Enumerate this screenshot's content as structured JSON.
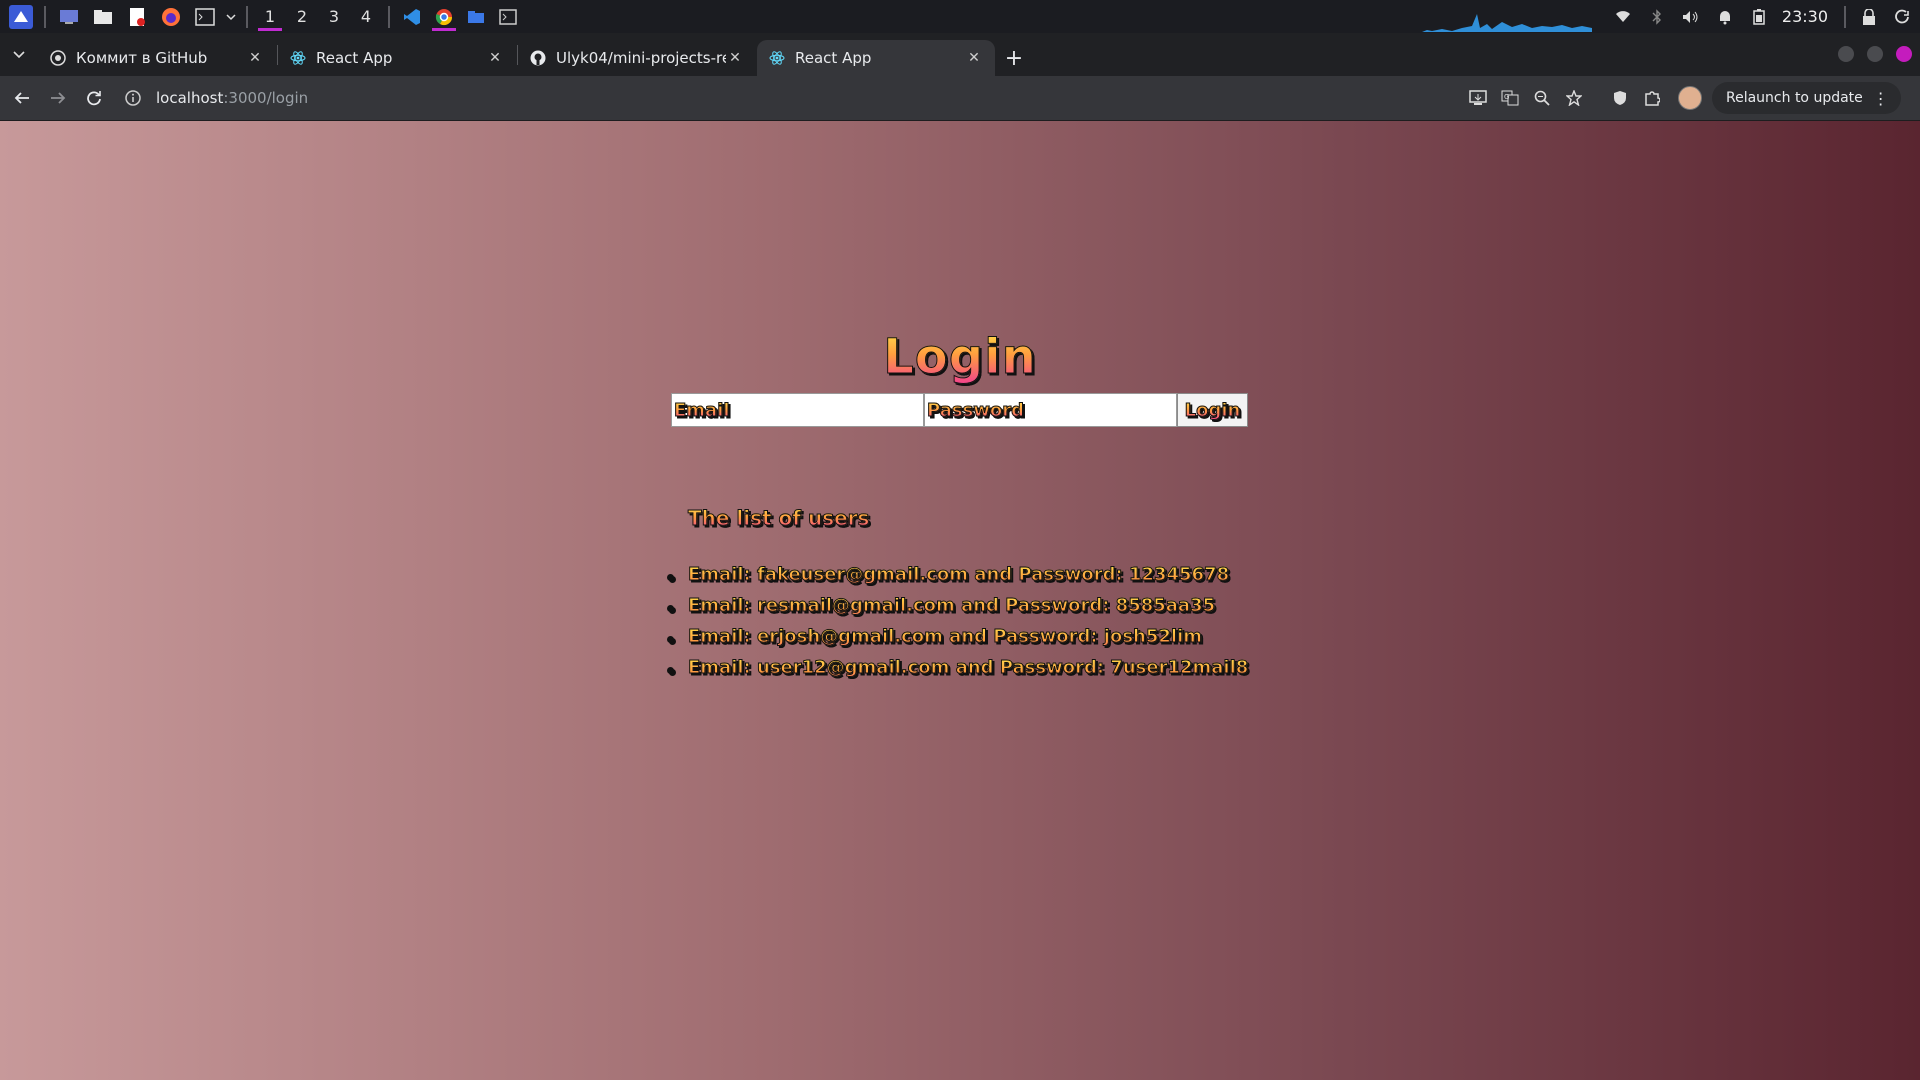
{
  "taskbar": {
    "workspaces": [
      "1",
      "2",
      "3",
      "4"
    ],
    "active_workspace": "1",
    "clock": "23:30",
    "launchers": [
      "app-menu-icon",
      "desktop-icon",
      "file-manager-icon",
      "text-editor-icon",
      "firefox-icon",
      "terminal-icon"
    ],
    "apps": [
      "vscode-icon",
      "chrome-icon",
      "folder-icon",
      "terminal-icon"
    ]
  },
  "browser": {
    "tabs": [
      {
        "title": "Коммит в GitHub",
        "favicon": "github-copilot-icon"
      },
      {
        "title": "React App",
        "favicon": "react-icon"
      },
      {
        "title": "Ulyk04/mini-projects-re",
        "favicon": "github-icon"
      },
      {
        "title": "React App",
        "favicon": "react-icon"
      }
    ],
    "active_tab": 3,
    "url_host": "localhost",
    "url_path": ":3000/login",
    "relaunch_label": "Relaunch to update"
  },
  "page": {
    "title": "Login",
    "email_placeholder": "Email",
    "password_placeholder": "Password",
    "login_button": "Login",
    "users_heading": "The list of users",
    "users": [
      "Email: fakeuser@gmail.com and Password: 12345678",
      "Email: resmail@gmail.com and Password: 8585aa35",
      "Email: erjosh@gmail.com and Password: josh52lim",
      "Email: user12@gmail.com and Password: 7user12mail8"
    ]
  },
  "colors": {
    "accent": "#c02bd0",
    "text_gradient_top": "#ffe14d",
    "text_gradient_bottom": "#f23f8f",
    "bg_left": "#c7999a",
    "bg_right": "#5a2530"
  }
}
